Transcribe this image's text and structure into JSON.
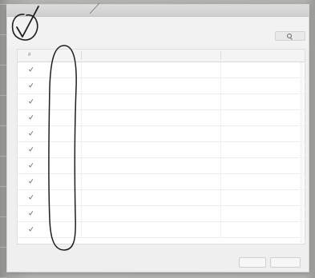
{
  "window": {
    "title": ""
  },
  "search": {
    "placeholder": "",
    "button_label": ""
  },
  "table": {
    "headers": [
      {
        "label": "#"
      },
      {
        "label": ""
      },
      {
        "label": ""
      }
    ],
    "rows": [
      {
        "col_b": "",
        "col_c": ""
      },
      {
        "col_b": "",
        "col_c": ""
      },
      {
        "col_b": "",
        "col_c": ""
      },
      {
        "col_b": "",
        "col_c": ""
      },
      {
        "col_b": "",
        "col_c": ""
      },
      {
        "col_b": "",
        "col_c": ""
      },
      {
        "col_b": "",
        "col_c": ""
      },
      {
        "col_b": "",
        "col_c": ""
      },
      {
        "col_b": "",
        "col_c": ""
      },
      {
        "col_b": "",
        "col_c": ""
      },
      {
        "col_b": "",
        "col_c": ""
      }
    ]
  },
  "footer": {
    "ok_label": "",
    "cancel_label": ""
  },
  "colors": {
    "check": "#6f6f6f",
    "annotation_ink": "#1e1e1e"
  },
  "icons": {
    "search": "magnifier-icon",
    "row_check": "checkmark-icon",
    "annotation_check": "handwritten-checkmark-icon"
  }
}
